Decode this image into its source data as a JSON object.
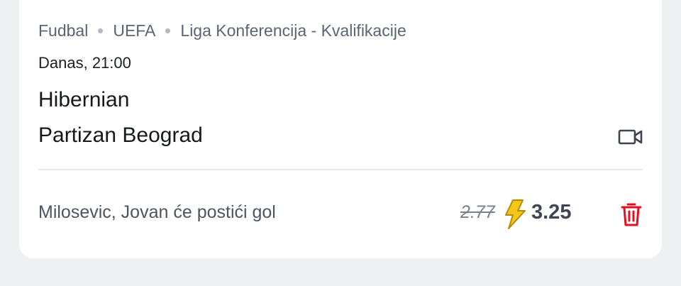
{
  "breadcrumb": {
    "sport": "Fudbal",
    "region": "UEFA",
    "competition": "Liga Konferencija - Kvalifikacije"
  },
  "match": {
    "datetime": "Danas, 21:00",
    "home_team": "Hibernian",
    "away_team": "Partizan Beograd"
  },
  "bet": {
    "selection": "Milosevic, Jovan će postići gol",
    "old_odds": "2.77",
    "new_odds": "3.25"
  },
  "icons": {
    "video": "video-camera-icon",
    "boost": "lightning-bolt-icon",
    "delete": "trash-icon"
  },
  "colors": {
    "boost": "#f5c518",
    "delete": "#e3111b",
    "background": "#eff0f2"
  }
}
